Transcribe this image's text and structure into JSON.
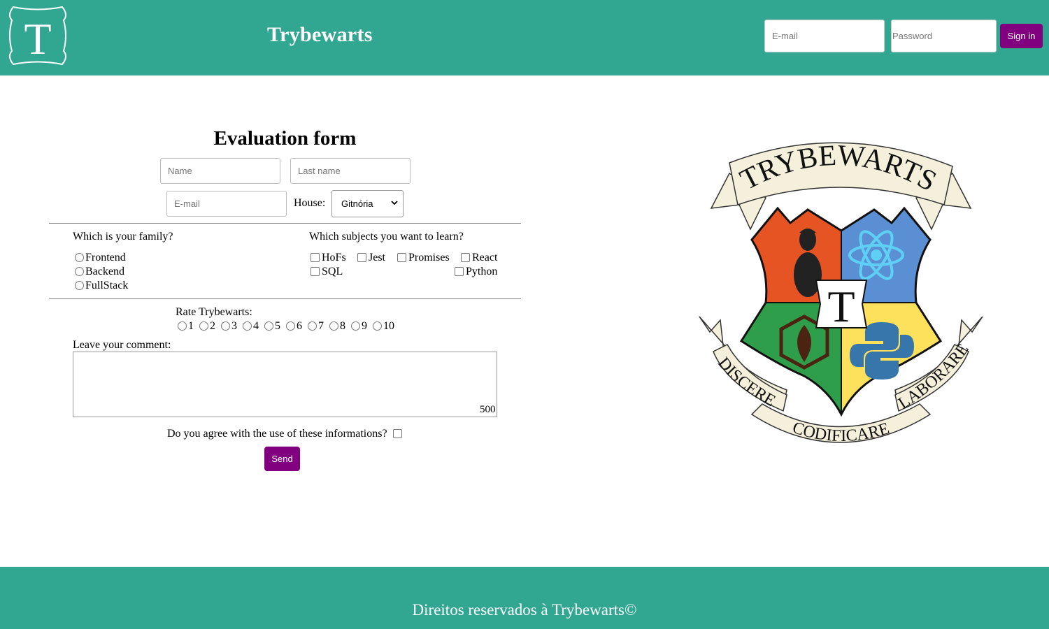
{
  "header": {
    "logo_letter": "T",
    "title": "Trybewarts",
    "login_email_placeholder": "E-mail",
    "login_password_placeholder": "Password",
    "signin_label": "Sign in"
  },
  "form": {
    "title": "Evaluation form",
    "name_placeholder": "Name",
    "lastname_placeholder": "Last name",
    "email_placeholder": "E-mail",
    "house_label": "House:",
    "house_selected": "Gitnória",
    "family_question": "Which is your family?",
    "family_options": [
      "Frontend",
      "Backend",
      "FullStack"
    ],
    "subjects_question": "Which subjects you want to learn?",
    "subject_options": [
      "HoFs",
      "Jest",
      "Promises",
      "React",
      "SQL",
      "Python"
    ],
    "rate_label": "Rate Trybewarts:",
    "rate_options": [
      "1",
      "2",
      "3",
      "4",
      "5",
      "6",
      "7",
      "8",
      "9",
      "10"
    ],
    "comment_label": "Leave your comment:",
    "char_counter": "500",
    "agreement_label": "Do you agree with the use of these informations?",
    "send_label": "Send"
  },
  "crest": {
    "banner_top": "TRYBEWARTS",
    "motto_left": "DISCERE",
    "motto_bottom": "CODIFICARE",
    "motto_right": "LABORARE",
    "center_letter": "T",
    "colors": {
      "red": "#e75424",
      "blue": "#5b8fd3",
      "green": "#2f9e4b",
      "yellow": "#fde05b",
      "ribbon": "#f5f0dc"
    }
  },
  "footer": {
    "text": "Direitos reservados à Trybewarts©"
  },
  "colors": {
    "teal": "#31a792",
    "purple": "#800080"
  }
}
